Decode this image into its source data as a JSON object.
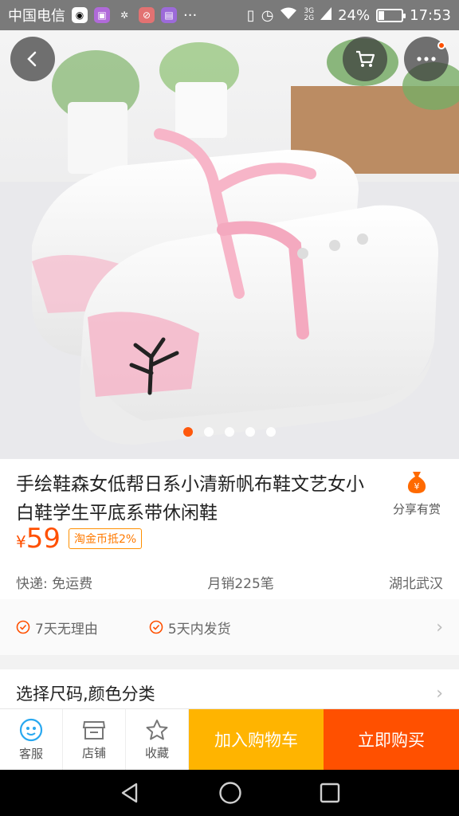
{
  "status_bar": {
    "carrier": "中国电信",
    "signal_small": [
      "3G",
      "2G"
    ],
    "battery": "24%",
    "battery_level": 0.24,
    "time": "17:53"
  },
  "hero": {
    "icons": {
      "back": "chevron-left-icon",
      "cart": "cart-icon",
      "more": "more-dots-icon"
    },
    "pager_count": 5,
    "pager_active": 0
  },
  "product": {
    "title": "手绘鞋森女低帮日系小清新帆布鞋文艺女小白鞋学生平底系带休闲鞋",
    "share_label": "分享有赏",
    "price_symbol": "¥",
    "price": "59",
    "coin_tag": "淘金币抵2%",
    "shipping": "快递: 免运费",
    "monthly_sales": "月销225笔",
    "location": "湖北武汉"
  },
  "guarantees": [
    "7天无理由",
    "5天内发货"
  ],
  "select_label": "选择尺码,颜色分类",
  "actions": {
    "service": "客服",
    "shop": "店铺",
    "favorite": "收藏",
    "add_cart": "加入购物车",
    "buy_now": "立即购买"
  },
  "colors": {
    "accent": "#ff5000",
    "cart": "#ffb400",
    "coin_border": "#ff9000"
  }
}
